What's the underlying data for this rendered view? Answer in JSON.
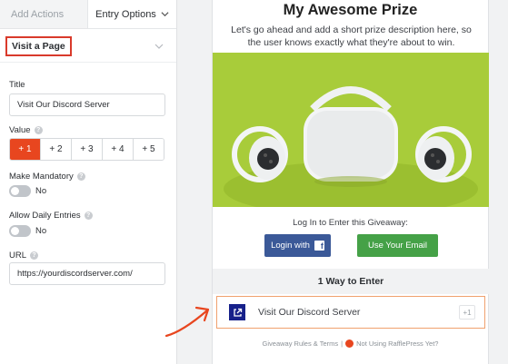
{
  "tabs": {
    "add_actions": "Add Actions",
    "entry_options": "Entry Options"
  },
  "section": {
    "title": "Visit a Page"
  },
  "form": {
    "title_label": "Title",
    "title_value": "Visit Our Discord Server",
    "value_label": "Value",
    "value_options": [
      "+ 1",
      "+ 2",
      "+ 3",
      "+ 4",
      "+ 5"
    ],
    "value_selected": "+ 1",
    "mandatory_label": "Make Mandatory",
    "mandatory_state": "No",
    "daily_label": "Allow Daily Entries",
    "daily_state": "No",
    "url_label": "URL",
    "url_value": "https://yourdiscordserver.com/"
  },
  "preview": {
    "prize_title": "My Awesome Prize",
    "prize_desc": "Let's go ahead and add a short prize description here, so the user knows exactly what they're about to win.",
    "login_label": "Log In to Enter this Giveaway:",
    "login_facebook": "Login with",
    "login_email": "Use Your Email",
    "ways_header": "1 Way to Enter",
    "entry_text": "Visit Our Discord Server",
    "entry_points": "+1",
    "footer_rules": "Giveaway Rules & Terms",
    "footer_sep": "|",
    "footer_rp": "Not Using RafflePress Yet?"
  },
  "colors": {
    "accent": "#e8461f",
    "highlight_border": "#d93a2b",
    "facebook": "#3b5998",
    "email_green": "#45a147",
    "entry_icon_bg": "#17218a",
    "image_bg": "#a8cc3a"
  },
  "icons": {
    "chevron": "chevron-down-icon",
    "help": "help-circle-icon",
    "facebook": "facebook-icon",
    "external_link": "external-link-icon",
    "rafflepress_logo": "rafflepress-logo"
  }
}
